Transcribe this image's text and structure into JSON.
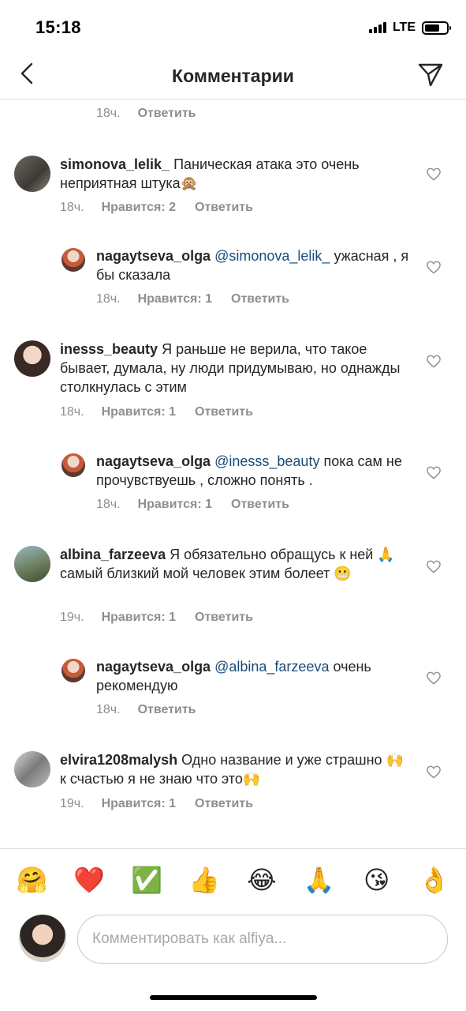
{
  "status": {
    "time": "15:18",
    "network": "LTE",
    "battery_percent": 70
  },
  "nav": {
    "title": "Комментарии"
  },
  "top_meta": {
    "time": "18ч.",
    "reply": "Ответить"
  },
  "comments": [
    {
      "user": "simonova_lelik_",
      "mention": "",
      "text": "Паническая атака это очень неприятная штука🙊",
      "time": "18ч.",
      "likes": "Нравится: 2",
      "reply": "Ответить"
    },
    {
      "user": "nagaytseva_olga",
      "mention": "@simonova_lelik_",
      "text": "ужасная , я бы сказала",
      "time": "18ч.",
      "likes": "Нравится: 1",
      "reply": "Ответить"
    },
    {
      "user": "inesss_beauty",
      "mention": "",
      "text": "Я раньше не верила, что такое бывает, думала, ну люди придумываю, но однажды столкнулась с этим",
      "time": "18ч.",
      "likes": "Нравится: 1",
      "reply": "Ответить"
    },
    {
      "user": "nagaytseva_olga",
      "mention": "@inesss_beauty",
      "text": "пока сам не прочувствуешь , сложно понять .",
      "time": "18ч.",
      "likes": "Нравится: 1",
      "reply": "Ответить"
    },
    {
      "user": "albina_farzeeva",
      "mention": "",
      "text": "Я обязательно обращусь к ней 🙏самый близкий мой человек этим болеет 😬",
      "time": "19ч.",
      "likes": "Нравится: 1",
      "reply": "Ответить"
    },
    {
      "user": "nagaytseva_olga",
      "mention": "@albina_farzeeva",
      "text": "очень рекомендую",
      "time": "18ч.",
      "likes": "",
      "reply": "Ответить"
    },
    {
      "user": "elvira1208malysh",
      "mention": "",
      "text": "Одно название и уже страшно 🙌к счастью я не знаю что это🙌",
      "time": "19ч.",
      "likes": "Нравится: 1",
      "reply": "Ответить"
    }
  ],
  "emojis": [
    "🤗",
    "❤️",
    "✅",
    "👍",
    "😂",
    "🙏",
    "😘",
    "👌"
  ],
  "composer": {
    "placeholder": "Комментировать как alfiya..."
  },
  "colors": {
    "text": "#262626",
    "meta": "#8e8e8e",
    "mention": "#1a4a7a",
    "divider": "#dbdbdb"
  }
}
